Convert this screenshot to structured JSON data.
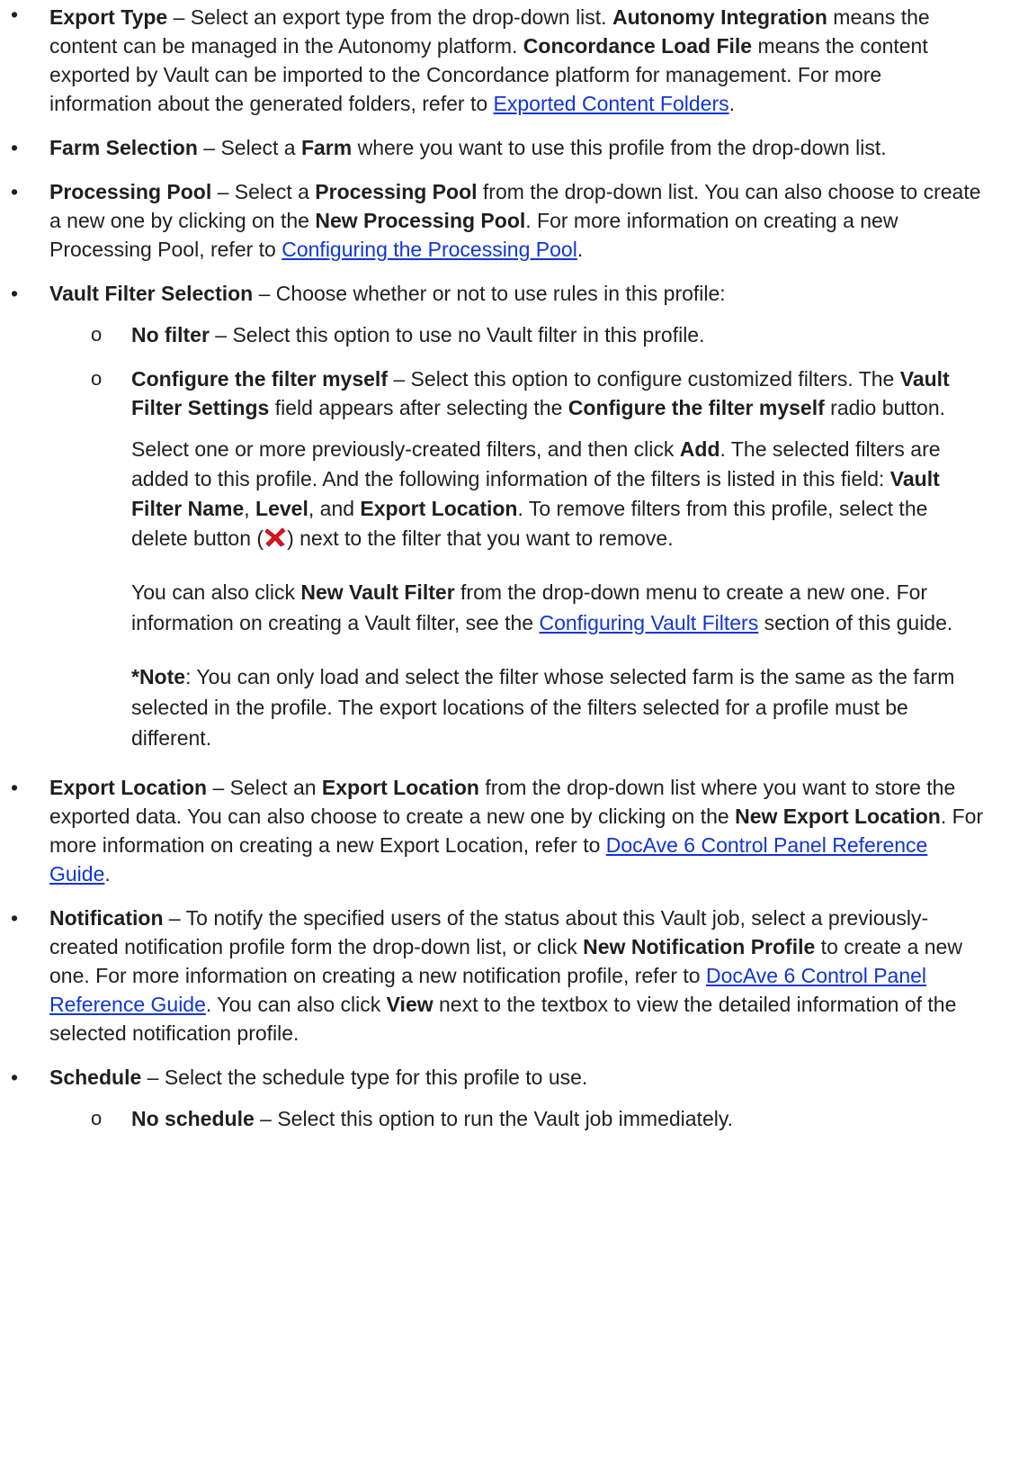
{
  "items": [
    {
      "term": "Export Type",
      "text1": " – Select an export type from the drop-down list. ",
      "b1": "Autonomy Integration",
      "text2": " means the content can be managed in the Autonomy platform. ",
      "b2": "Concordance Load File",
      "text3": " means the content exported by Vault can be imported to the Concordance platform for management. For more information about the generated folders, refer to ",
      "link": "Exported Content Folders",
      "end": "."
    },
    {
      "term": "Farm Selection",
      "text1": " – Select a ",
      "b1": "Farm",
      "text2": " where you want to use this profile from the drop-down list."
    },
    {
      "term": "Processing Pool",
      "text1": " – Select a ",
      "b1": "Processing Pool",
      "text2": " from the drop-down list. You can also choose to create a new one by clicking on the ",
      "b2": "New Processing Pool",
      "text3": ". For more information on creating a new Processing Pool, refer to ",
      "link": "Configuring the Processing Pool",
      "end": "."
    },
    {
      "term": "Vault Filter Selection",
      "text1": " – Choose whether or not to use rules in this profile:",
      "sub": [
        {
          "term": "No filter",
          "text1": " – Select this option to use no Vault filter in this profile."
        },
        {
          "term": "Configure the filter myself",
          "text1": " – Select this option to configure customized filters. The ",
          "b1": "Vault Filter Settings",
          "text2": " field appears after selecting the ",
          "b2": "Configure the filter myself",
          "text3": " radio button.",
          "p1": {
            "t1": "Select one or more previously-created filters, and then click ",
            "b1": "Add",
            "t2": ". The selected filters are added to this profile. And the following information of the filters is listed in this field: ",
            "b2": "Vault Filter Name",
            "t3": ", ",
            "b3": "Level",
            "t4": ", and ",
            "b4": "Export Location",
            "t5": ". To remove filters from this profile, select the delete button (",
            "t6": ") next to the filter that you want to remove."
          },
          "p2": {
            "t1": "You can also click ",
            "b1": "New Vault Filter",
            "t2": " from the drop-down menu to create a new one. For information on creating a Vault filter, see the ",
            "link": "Configuring Vault Filters",
            "t3": " section of this guide."
          },
          "p3": {
            "b1": "*Note",
            "t1": ": You can only load and select the filter whose selected farm is the same as the farm selected in the profile. The export locations of the filters selected for a profile must be different."
          }
        }
      ]
    },
    {
      "term": "Export Location",
      "text1": " – Select an ",
      "b1": "Export Location",
      "text2": " from the drop-down list where you want to store the exported data. You can also choose to create a new one by clicking on the ",
      "b2": "New Export Location",
      "text3": ". For more information on creating a new Export Location, refer to ",
      "link": "DocAve 6 Control Panel Reference Guide",
      "end": "."
    },
    {
      "term": "Notification",
      "text1": " – To notify the specified users of the status about this Vault job, select a previously-created notification profile form the drop-down list, or click ",
      "b1": "New Notification Profile",
      "text2": " to create a new one. For more information on creating a new notification profile, refer to ",
      "link": "DocAve 6 Control Panel Reference Guide",
      "text3": ". You can also click ",
      "b2": "View",
      "text4": " next to the textbox to view the detailed information of the selected notification profile."
    },
    {
      "term": "Schedule",
      "text1": " – Select the schedule type for this profile to use.",
      "sub": [
        {
          "term": "No schedule",
          "text1": " – Select this option to run the Vault job immediately."
        }
      ]
    }
  ],
  "colors": {
    "link": "#0f36d6",
    "text": "#1f1f1f",
    "delete_icon": "#e0141e"
  },
  "icons": {
    "delete": "red-x-icon"
  }
}
